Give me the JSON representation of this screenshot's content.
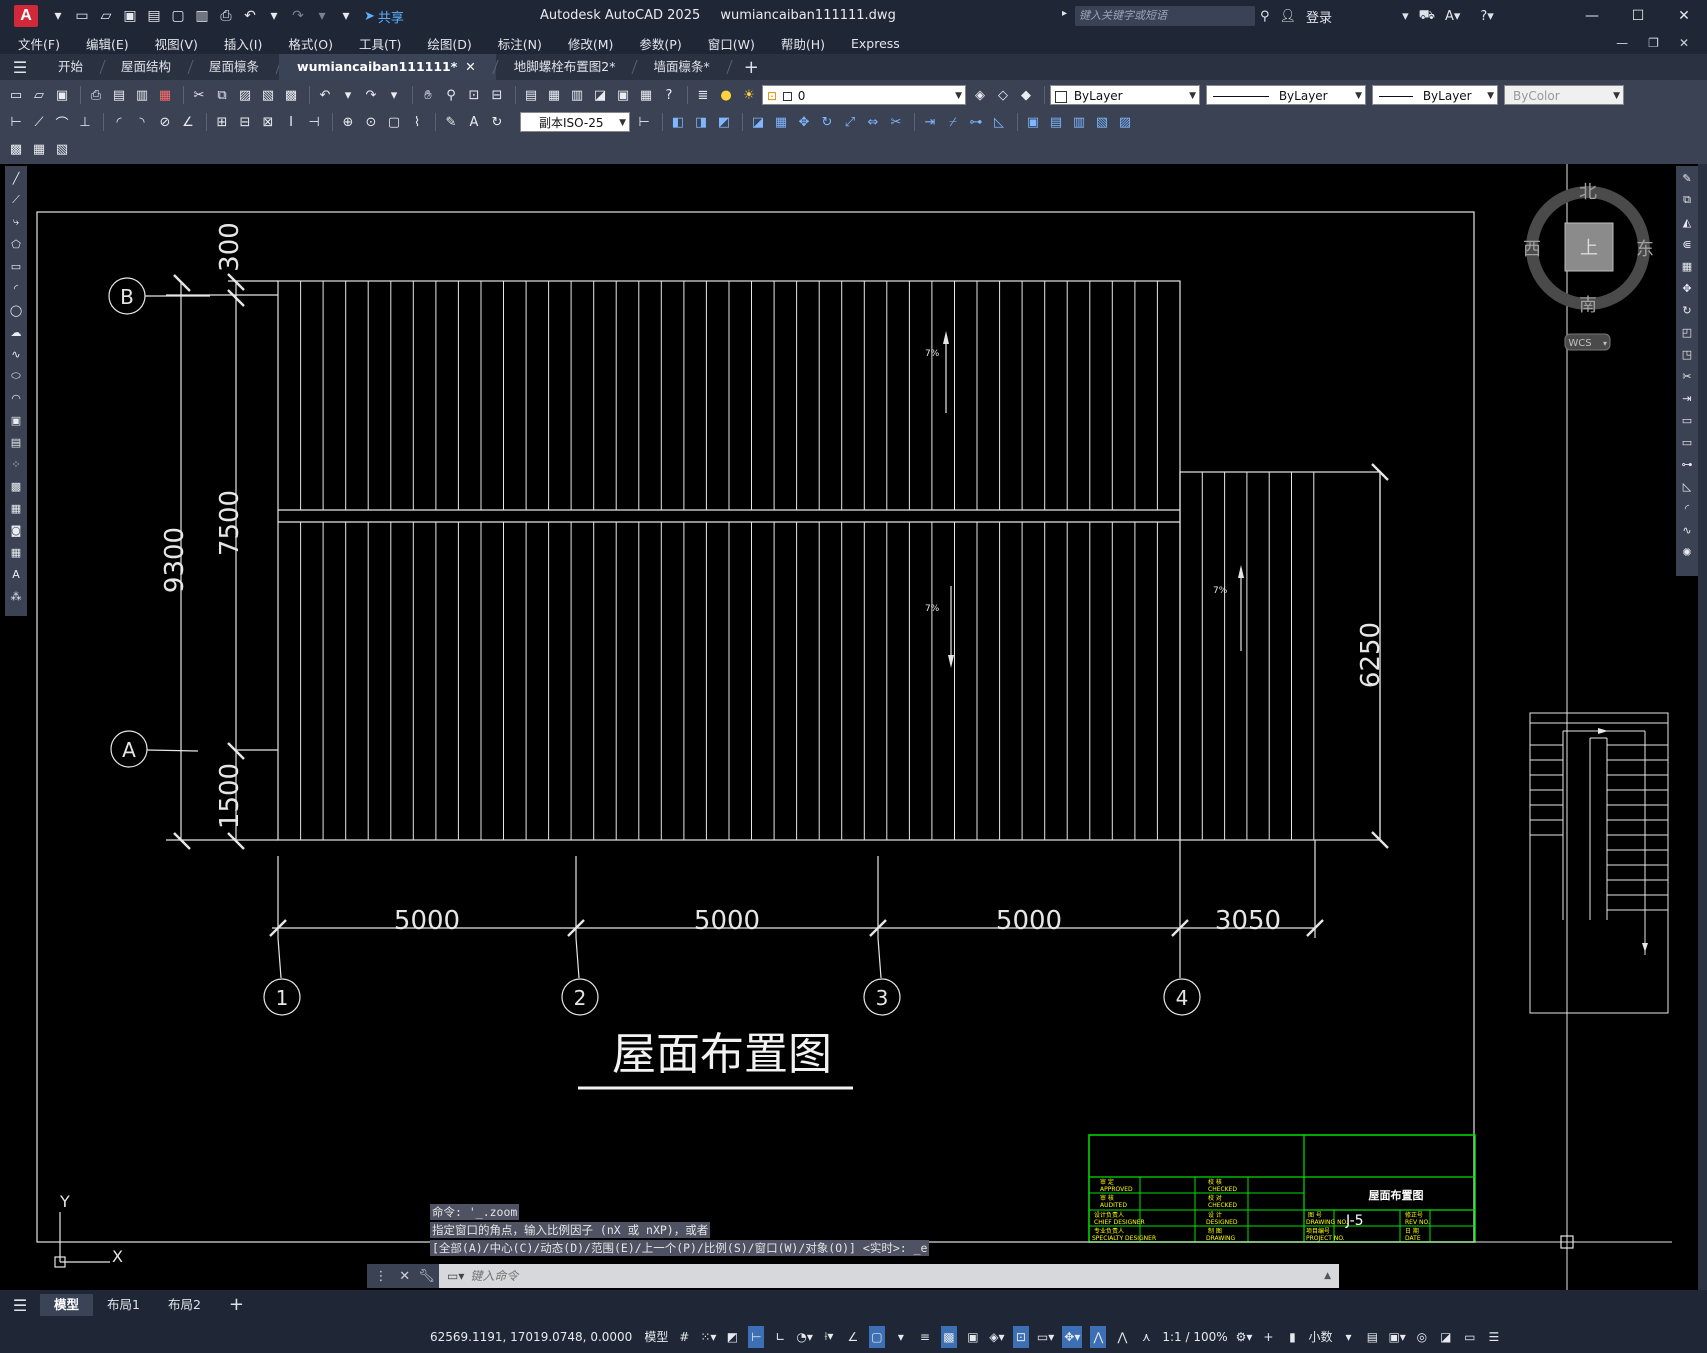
{
  "titlebar": {
    "app_logo": "A",
    "share_label": "共享",
    "app_name": "Autodesk AutoCAD 2025",
    "file_name": "wumiancaiban111111.dwg",
    "search_placeholder": "键入关键字或短语",
    "login_label": "登录"
  },
  "menu": [
    "文件(F)",
    "编辑(E)",
    "视图(V)",
    "插入(I)",
    "格式(O)",
    "工具(T)",
    "绘图(D)",
    "标注(N)",
    "修改(M)",
    "参数(P)",
    "窗口(W)",
    "帮助(H)",
    "Express"
  ],
  "tabs": [
    {
      "label": "开始",
      "active": false
    },
    {
      "label": "屋面结构",
      "active": false
    },
    {
      "label": "屋面檩条",
      "active": false
    },
    {
      "label": "wumiancaiban111111*",
      "active": true
    },
    {
      "label": "地脚螺栓布置图2*",
      "active": false
    },
    {
      "label": "墙面檩条*",
      "active": false
    }
  ],
  "toolbar": {
    "layer_value": "0",
    "color_value": "ByLayer",
    "linetype_value": "ByLayer",
    "lineweight_value": "ByLayer",
    "plotstyle_value": "ByColor",
    "dimstyle_value": "副本ISO-25"
  },
  "drawing": {
    "title": "屋面布置图",
    "axis_rows": [
      "B",
      "A"
    ],
    "axis_cols": [
      "1",
      "2",
      "3",
      "4"
    ],
    "dims_bottom": [
      "5000",
      "5000",
      "5000",
      "3050"
    ],
    "dims_left_outer": "9300",
    "dims_left_inner": [
      "300",
      "7500",
      "1500"
    ],
    "dim_right": "6250",
    "slope_labels": [
      "7%",
      "7%",
      "7%"
    ],
    "viewcube": {
      "north": "北",
      "south": "南",
      "east": "东",
      "west": "西",
      "top": "上",
      "wcs": "WCS"
    },
    "ucs_x": "X",
    "ucs_y": "Y",
    "titleblock": {
      "drawing_name": "屋面布置图",
      "drawing_no": "J-5",
      "row_labels_left": [
        "审  定",
        "APPROVED",
        "审  核",
        "AUDITED",
        "设计负责人",
        "CHIEF DESIGNER",
        "专业负责人",
        "SPECIALTY DESIGNER"
      ],
      "row_labels_mid": [
        "校  核",
        "CHECKED",
        "校  对",
        "CHECKED",
        "设  计",
        "DESIGNED",
        "制  图",
        "DRAWING"
      ],
      "row_labels_right": [
        "图  号",
        "DRAWING NO.",
        "项目编号",
        "PROJECT NO.",
        "修正号",
        "REV NO.",
        "日  期",
        "DATE"
      ]
    }
  },
  "command": {
    "history": [
      "命令: '_.zoom",
      "指定窗口的角点，输入比例因子 (nX 或 nXP)，或者",
      "[全部(A)/中心(C)/动态(D)/范围(E)/上一个(P)/比例(S)/窗口(W)/对象(O)] <实时>: _e"
    ],
    "placeholder": "键入命令"
  },
  "layout_tabs": [
    {
      "label": "模型",
      "active": true
    },
    {
      "label": "布局1",
      "active": false
    },
    {
      "label": "布局2",
      "active": false
    }
  ],
  "status": {
    "coords": "62569.1191, 17019.0748, 0.0000",
    "space": "模型",
    "scale": "1:1 / 100%",
    "units": "小数"
  }
}
